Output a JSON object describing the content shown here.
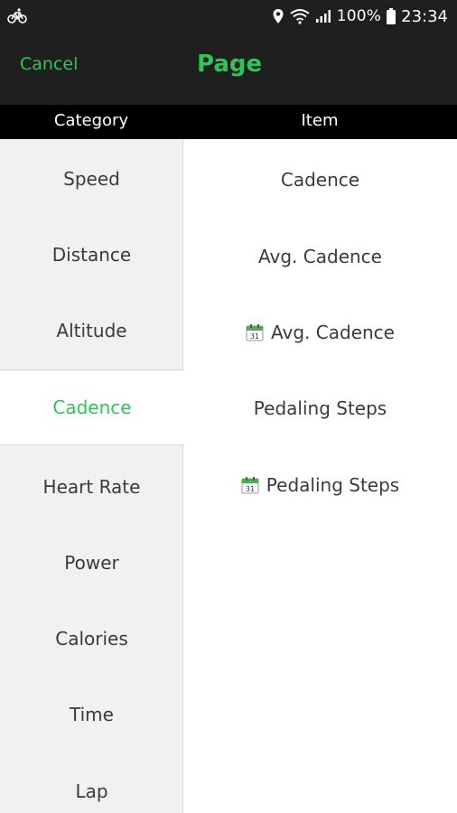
{
  "status_bar": {
    "battery": "100%",
    "time": "23:34"
  },
  "app_bar": {
    "cancel_label": "Cancel",
    "title": "Page"
  },
  "columns": {
    "category_header": "Category",
    "item_header": "Item"
  },
  "categories": [
    "Speed",
    "Distance",
    "Altitude",
    "Cadence",
    "Heart Rate",
    "Power",
    "Calories",
    "Time",
    "Lap"
  ],
  "selected_category": "Cadence",
  "items": [
    {
      "label": "Cadence",
      "icon": ""
    },
    {
      "label": "Avg. Cadence",
      "icon": ""
    },
    {
      "label": "Avg. Cadence",
      "icon": "calendar-icon"
    },
    {
      "label": "Pedaling Steps",
      "icon": ""
    },
    {
      "label": "Pedaling Steps",
      "icon": "calendar-icon"
    }
  ],
  "calendar_icon_day": "31",
  "colors": {
    "accent": "#2ec45a",
    "bar": "#1f1f1f",
    "header": "#000000",
    "category_bg": "#f1f1f1"
  }
}
